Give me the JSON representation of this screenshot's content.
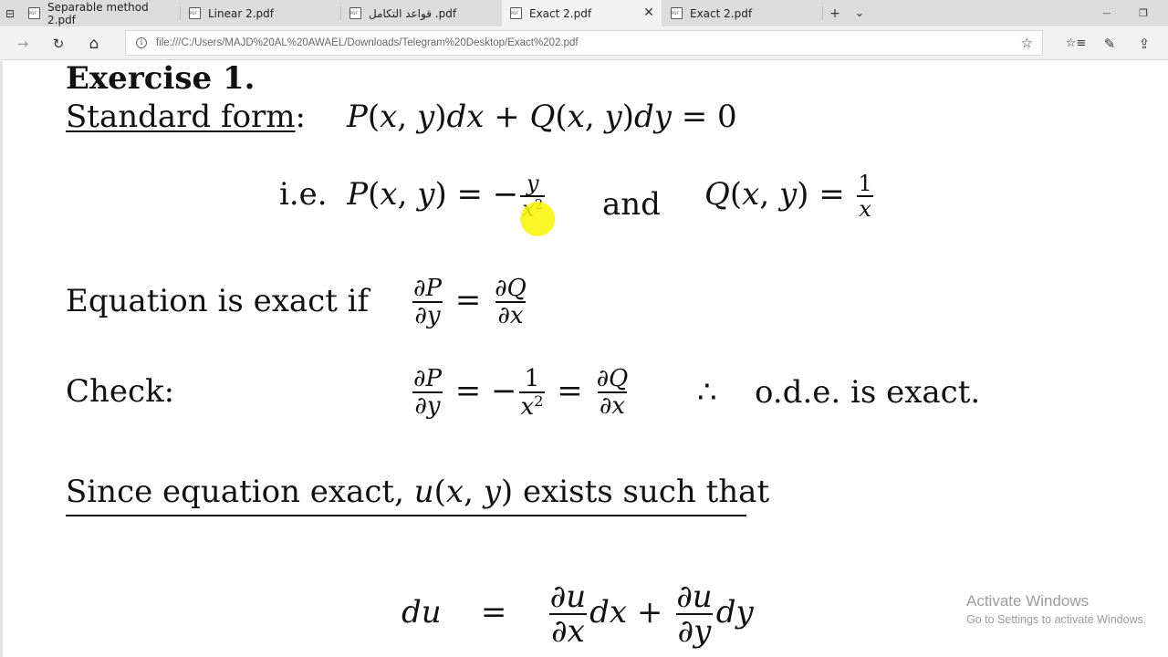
{
  "tabs": [
    {
      "title": "Separable method 2.pdf",
      "active": false
    },
    {
      "title": "Linear 2.pdf",
      "active": false
    },
    {
      "title": "pdf. قواعد التكامل",
      "active": false
    },
    {
      "title": "Exact 2.pdf",
      "active": true
    },
    {
      "title": "Exact 2.pdf",
      "active": false
    }
  ],
  "tabbar": {
    "new_tab": "+",
    "tab_list": "⌄",
    "minimize": "—",
    "restore": "❐"
  },
  "address": {
    "url": "file:///C:/Users/MAJD%20AL%20AWAEL/Downloads/Telegram%20Desktop/Exact%202.pdf"
  },
  "nav": {
    "forward": "→",
    "refresh": "↻",
    "home": "⌂",
    "favorites": "☆",
    "hub": "☆≡",
    "notes": "✎",
    "share": "⇪"
  },
  "document": {
    "exercise_title": "Exercise 1.",
    "standard_form_label": "Standard form",
    "standard_form_colon": ":",
    "ie": "i.e.",
    "and": "and",
    "exact_if": "Equation is exact if",
    "check": "Check:",
    "therefore": "∴",
    "ode_exact": "o.d.e.  is exact.",
    "since_text_1": "Since equation exact,",
    "since_text_2": "exists such that"
  },
  "watermark": {
    "line1": "Activate Windows",
    "line2": "Go to Settings to activate Windows."
  },
  "colors": {
    "cursor_highlight": "#faf500",
    "tab_strip": "#dcdcdc",
    "active_tab": "#f2f2f2"
  }
}
